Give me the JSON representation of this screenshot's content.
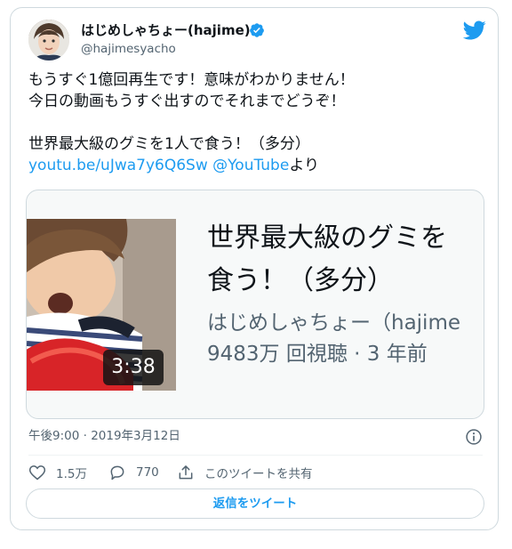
{
  "author": {
    "display_name": "はじめしゃちょー(hajime)",
    "handle": "@hajimesyacho",
    "verified": true
  },
  "icons": {
    "avatar": "profile-photo",
    "verified": "verified-badge-icon",
    "brand": "twitter-bird-icon",
    "info": "info-icon",
    "like": "heart-icon",
    "reply": "reply-bubble-icon",
    "share": "share-icon"
  },
  "colors": {
    "accent": "#1d9bf0",
    "text": "#0f1419",
    "secondary": "#536471",
    "border": "#cfd9de"
  },
  "tweet": {
    "line1": "もうすぐ1億回再生です！意味がわかりません！",
    "line2": "今日の動画もうすぐ出すのでそれまでどうぞ！",
    "line3": "世界最大級のグミを1人で食う！（多分）",
    "link_url": "youtu.be/uJwa7y6Q6Sw",
    "link_mention": "@YouTube",
    "link_suffix": "より"
  },
  "media": {
    "duration": "3:38",
    "title_line1": "世界最大級のグミを",
    "title_line2": "食う！（多分）",
    "channel": "はじめしゃちょー（hajime",
    "views": "9483万 回視聴 · 3 年前"
  },
  "timestamp": "午後9:00 · 2019年3月12日",
  "actions": {
    "likes": "1.5万",
    "replies": "770",
    "share_label": "このツイートを共有"
  },
  "reply_button": "返信をツイート"
}
